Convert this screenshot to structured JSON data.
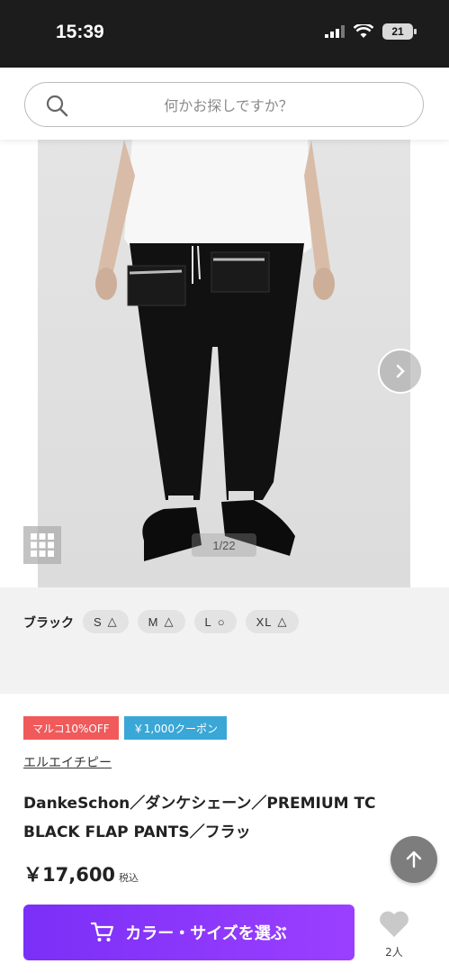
{
  "status": {
    "time": "15:39",
    "battery": "21"
  },
  "search": {
    "placeholder": "何かお探しですか？"
  },
  "gallery": {
    "counter": "1/22"
  },
  "variants": {
    "color": "ブラック",
    "sizes": [
      {
        "label": "S",
        "stock": "△"
      },
      {
        "label": "M",
        "stock": "△"
      },
      {
        "label": "L",
        "stock": "○"
      },
      {
        "label": "XL",
        "stock": "△"
      }
    ]
  },
  "badges": [
    {
      "label": "マルコ10%OFF",
      "color": "#f05a5a"
    },
    {
      "label": "￥1,000クーポン",
      "color": "#3aa7d6"
    }
  ],
  "brand": "エルエイチピー",
  "title": "DankeSchon／ダンケシェーン／PREMIUM TC BLACK FLAP PANTS／フラッ",
  "price": {
    "value": "￥17,600",
    "tax": "税込"
  },
  "buy_button": {
    "label": "カラー・サイズを選ぶ"
  },
  "favorite": {
    "count": "2人"
  },
  "icons": {
    "search": "search-icon",
    "next": "chevron-right-icon",
    "grid": "grid-icon",
    "scroll_top": "arrow-up-icon",
    "cart": "cart-icon",
    "heart": "heart-icon"
  },
  "colors": {
    "accent": "#8a35fb",
    "status_bar": "#1c1c1c"
  }
}
